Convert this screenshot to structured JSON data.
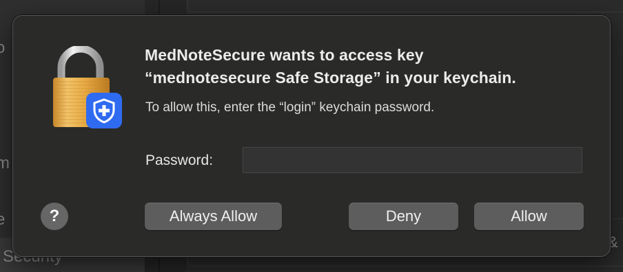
{
  "background": {
    "sidebar_fragments": [
      "o",
      "m",
      "e",
      "Security"
    ],
    "panel_fragment": "&"
  },
  "dialog": {
    "icon": "keychain-lock-icon",
    "badge_icon": "shield-plus-icon",
    "title_line1": "MedNoteSecure wants to access key",
    "title_line2": "“mednotesecure Safe Storage” in your keychain.",
    "subtitle": "To allow this, enter the “login” keychain password.",
    "password_label": "Password:",
    "password_value": "",
    "help_label": "?",
    "buttons": {
      "always_allow": "Always Allow",
      "deny": "Deny",
      "allow": "Allow"
    }
  },
  "colors": {
    "dialog_bg": "#2a2a29",
    "button_bg": "#5d5d5d",
    "badge_blue": "#2f6bf1",
    "lock_gold": "#e6a53a"
  }
}
